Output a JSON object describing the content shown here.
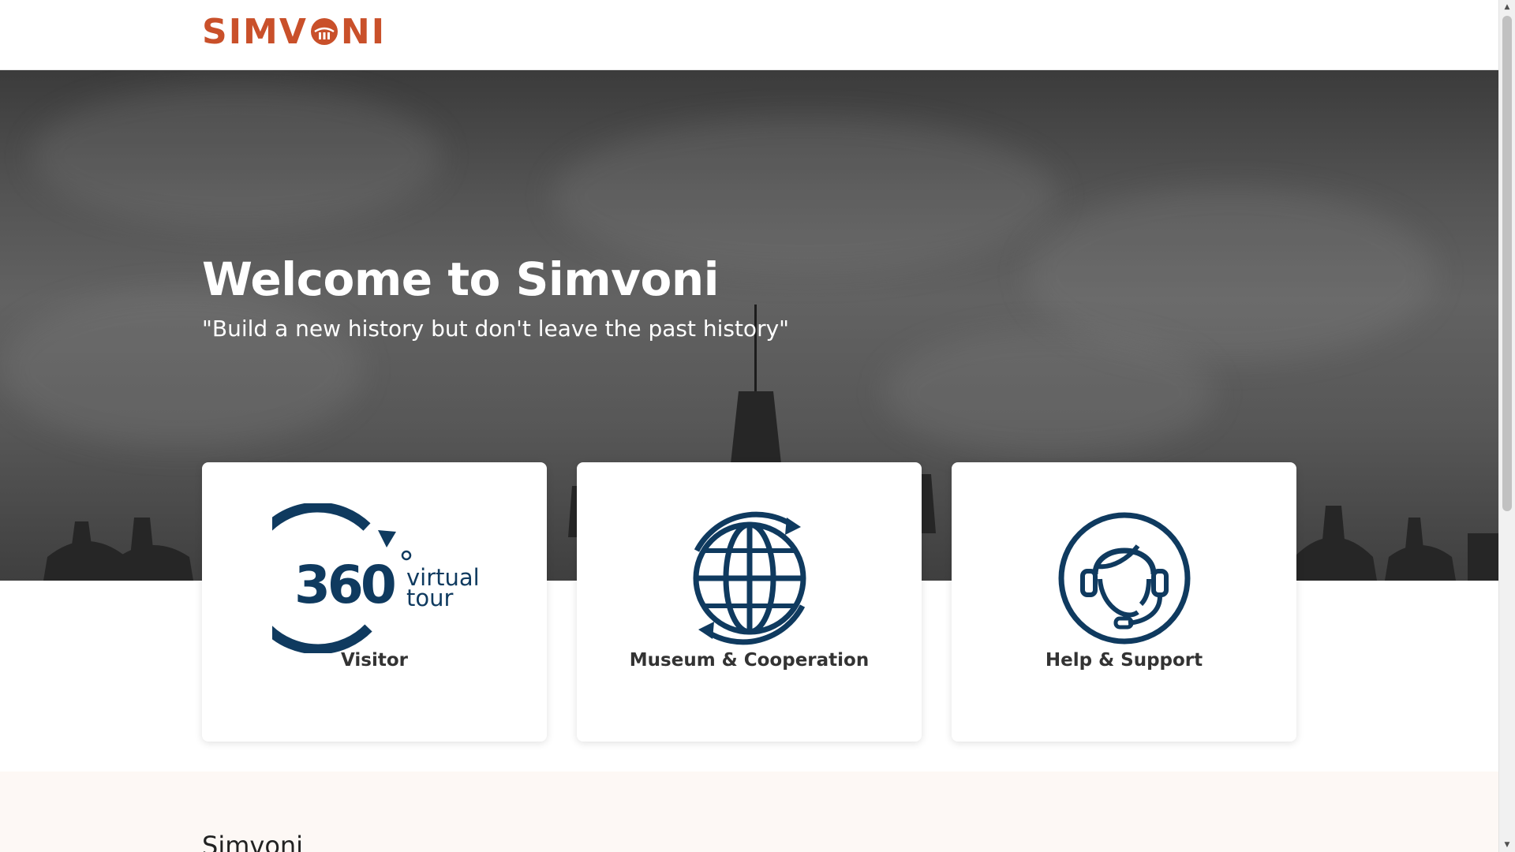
{
  "header": {
    "logo_text": "SIMVONI",
    "logo_prefix": "SIMV",
    "logo_suffix": "NI"
  },
  "hero": {
    "title": "Welcome to Simvoni",
    "quote": "\"Build a new history but don't leave the past history\""
  },
  "cards": [
    {
      "label": "Visitor",
      "icon": "360-virtual-tour-icon",
      "icon_text_main": "360",
      "icon_text_sub1": "virtual",
      "icon_text_sub2": "tour"
    },
    {
      "label": "Museum & Cooperation",
      "icon": "globe-icon"
    },
    {
      "label": "Help & Support",
      "icon": "headset-support-icon"
    }
  ],
  "about": {
    "title": "Simvoni"
  },
  "colors": {
    "brand": "#c9502a",
    "icon_navy": "#0f3a5f",
    "about_bg": "#fdf8f5"
  }
}
